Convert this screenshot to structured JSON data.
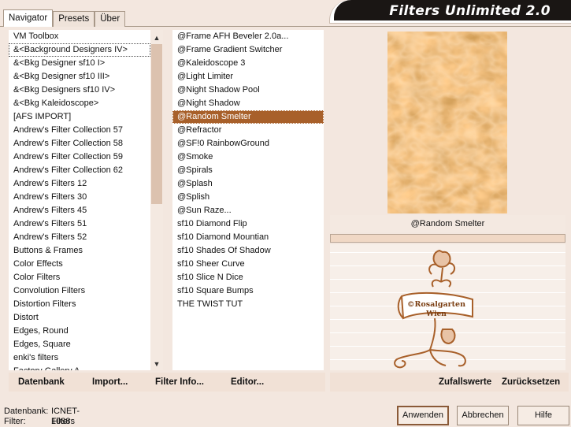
{
  "tabs": [
    "Navigator",
    "Presets",
    "Über"
  ],
  "app_title": "Filters Unlimited 2.0",
  "categories": [
    "VM Toolbox",
    "&<Background Designers IV>",
    "&<Bkg Designer sf10 I>",
    "&<Bkg Designer sf10 III>",
    "&<Bkg Designers sf10 IV>",
    "&<Bkg Kaleidoscope>",
    "[AFS IMPORT]",
    "Andrew's Filter Collection 57",
    "Andrew's Filter Collection 58",
    "Andrew's Filter Collection 59",
    "Andrew's Filter Collection 62",
    "Andrew's Filters 12",
    "Andrew's Filters 30",
    "Andrew's Filters 45",
    "Andrew's Filters 51",
    "Andrew's Filters 52",
    "Buttons & Frames",
    "Color Effects",
    "Color Filters",
    "Convolution Filters",
    "Distortion Filters",
    "Distort",
    "Edges, Round",
    "Edges, Square",
    "enki's filters",
    "Factory Gallery A"
  ],
  "selected_category_index": 1,
  "filters": [
    "@Frame AFH Beveler 2.0a...",
    "@Frame Gradient Switcher",
    "@Kaleidoscope 3",
    "@Light Limiter",
    "@Night Shadow Pool",
    "@Night Shadow",
    "@Random Smelter",
    "@Refractor",
    "@SF!0 RainbowGround",
    "@Smoke",
    "@Spirals",
    "@Splash",
    "@Splish",
    "@Sun Raze...",
    "sf10 Diamond Flip",
    "sf10 Diamond Mountian",
    "sf10 Shades Of Shadow",
    "sf10 Sheer Curve",
    "sf10 Slice N Dice",
    "sf10 Square Bumps",
    "THE TWIST TUT"
  ],
  "selected_filter_index": 6,
  "selected_filter_name": "@Random Smelter",
  "toolbar": {
    "datenbank": "Datenbank",
    "import": "Import...",
    "filter_info": "Filter Info...",
    "editor": "Editor...",
    "zufallswerte": "Zufallswerte",
    "zuruecksetzen": "Zurücksetzen"
  },
  "status": {
    "datenbank_label": "Datenbank:",
    "datenbank_value": "ICNET-Filters",
    "filter_label": "Filter:",
    "filter_value": "1088"
  },
  "buttons": {
    "apply": "Anwenden",
    "cancel": "Abbrechen",
    "help": "Hilfe"
  },
  "watermark_text": [
    "©Rosalgarten",
    "Wien"
  ],
  "colors": {
    "accent": "#a8602a",
    "preview": "#b56522",
    "background": "#f3e7df"
  }
}
